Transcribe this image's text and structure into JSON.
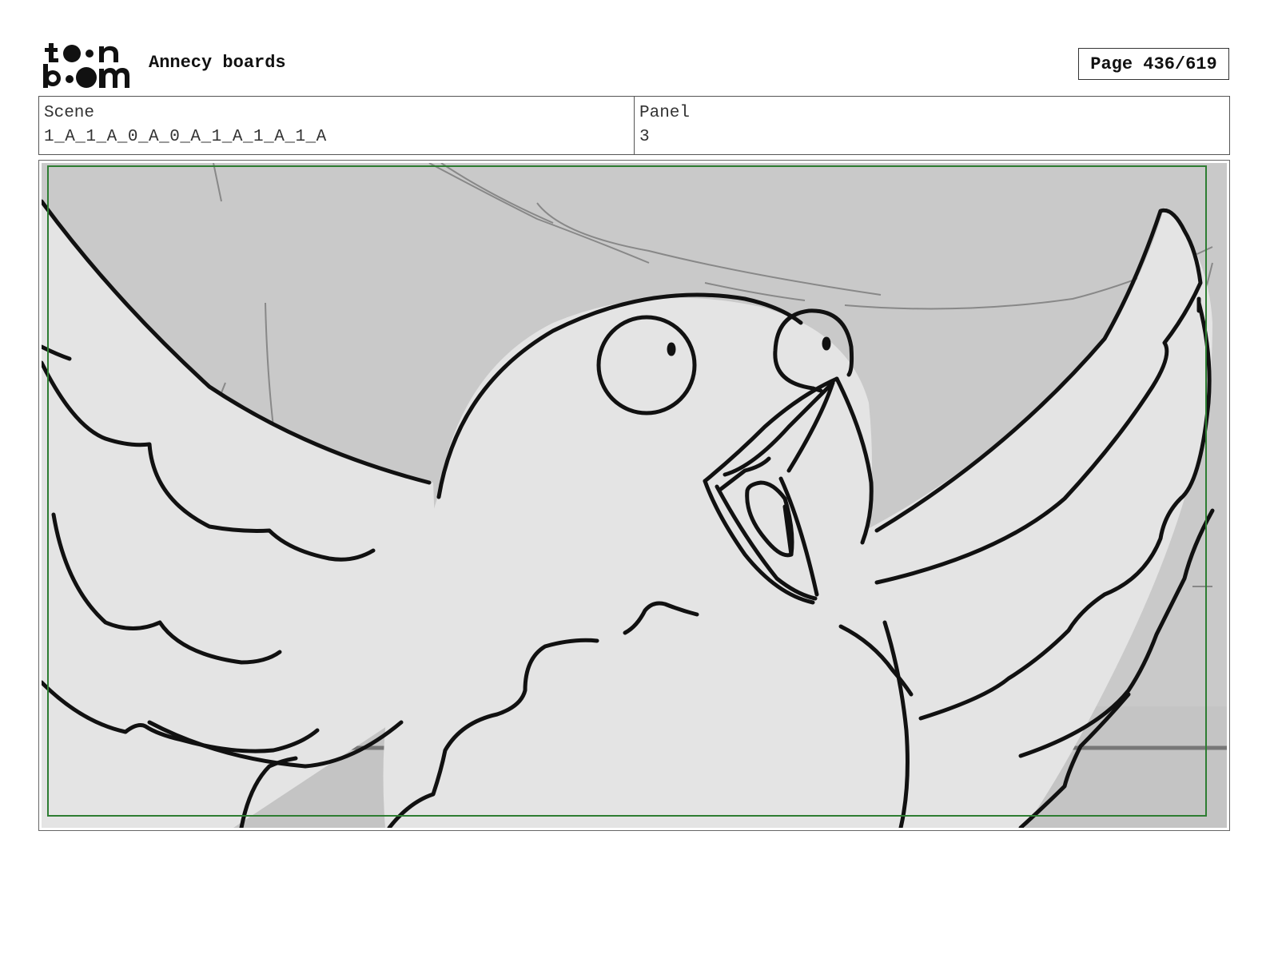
{
  "header": {
    "logo_text": "toon boom",
    "title": "Annecy boards",
    "page_label": "Page 436/619"
  },
  "info": {
    "scene_label": "Scene",
    "scene_value": "1_A_1_A_0_A_0_A_1_A_1_A_1_A",
    "panel_label": "Panel",
    "panel_value": "3"
  },
  "colors": {
    "sky": "#c9c9c9",
    "bird_fill": "#e4e4e4",
    "safe_frame": "#2e7d32",
    "ink": "#111111"
  }
}
